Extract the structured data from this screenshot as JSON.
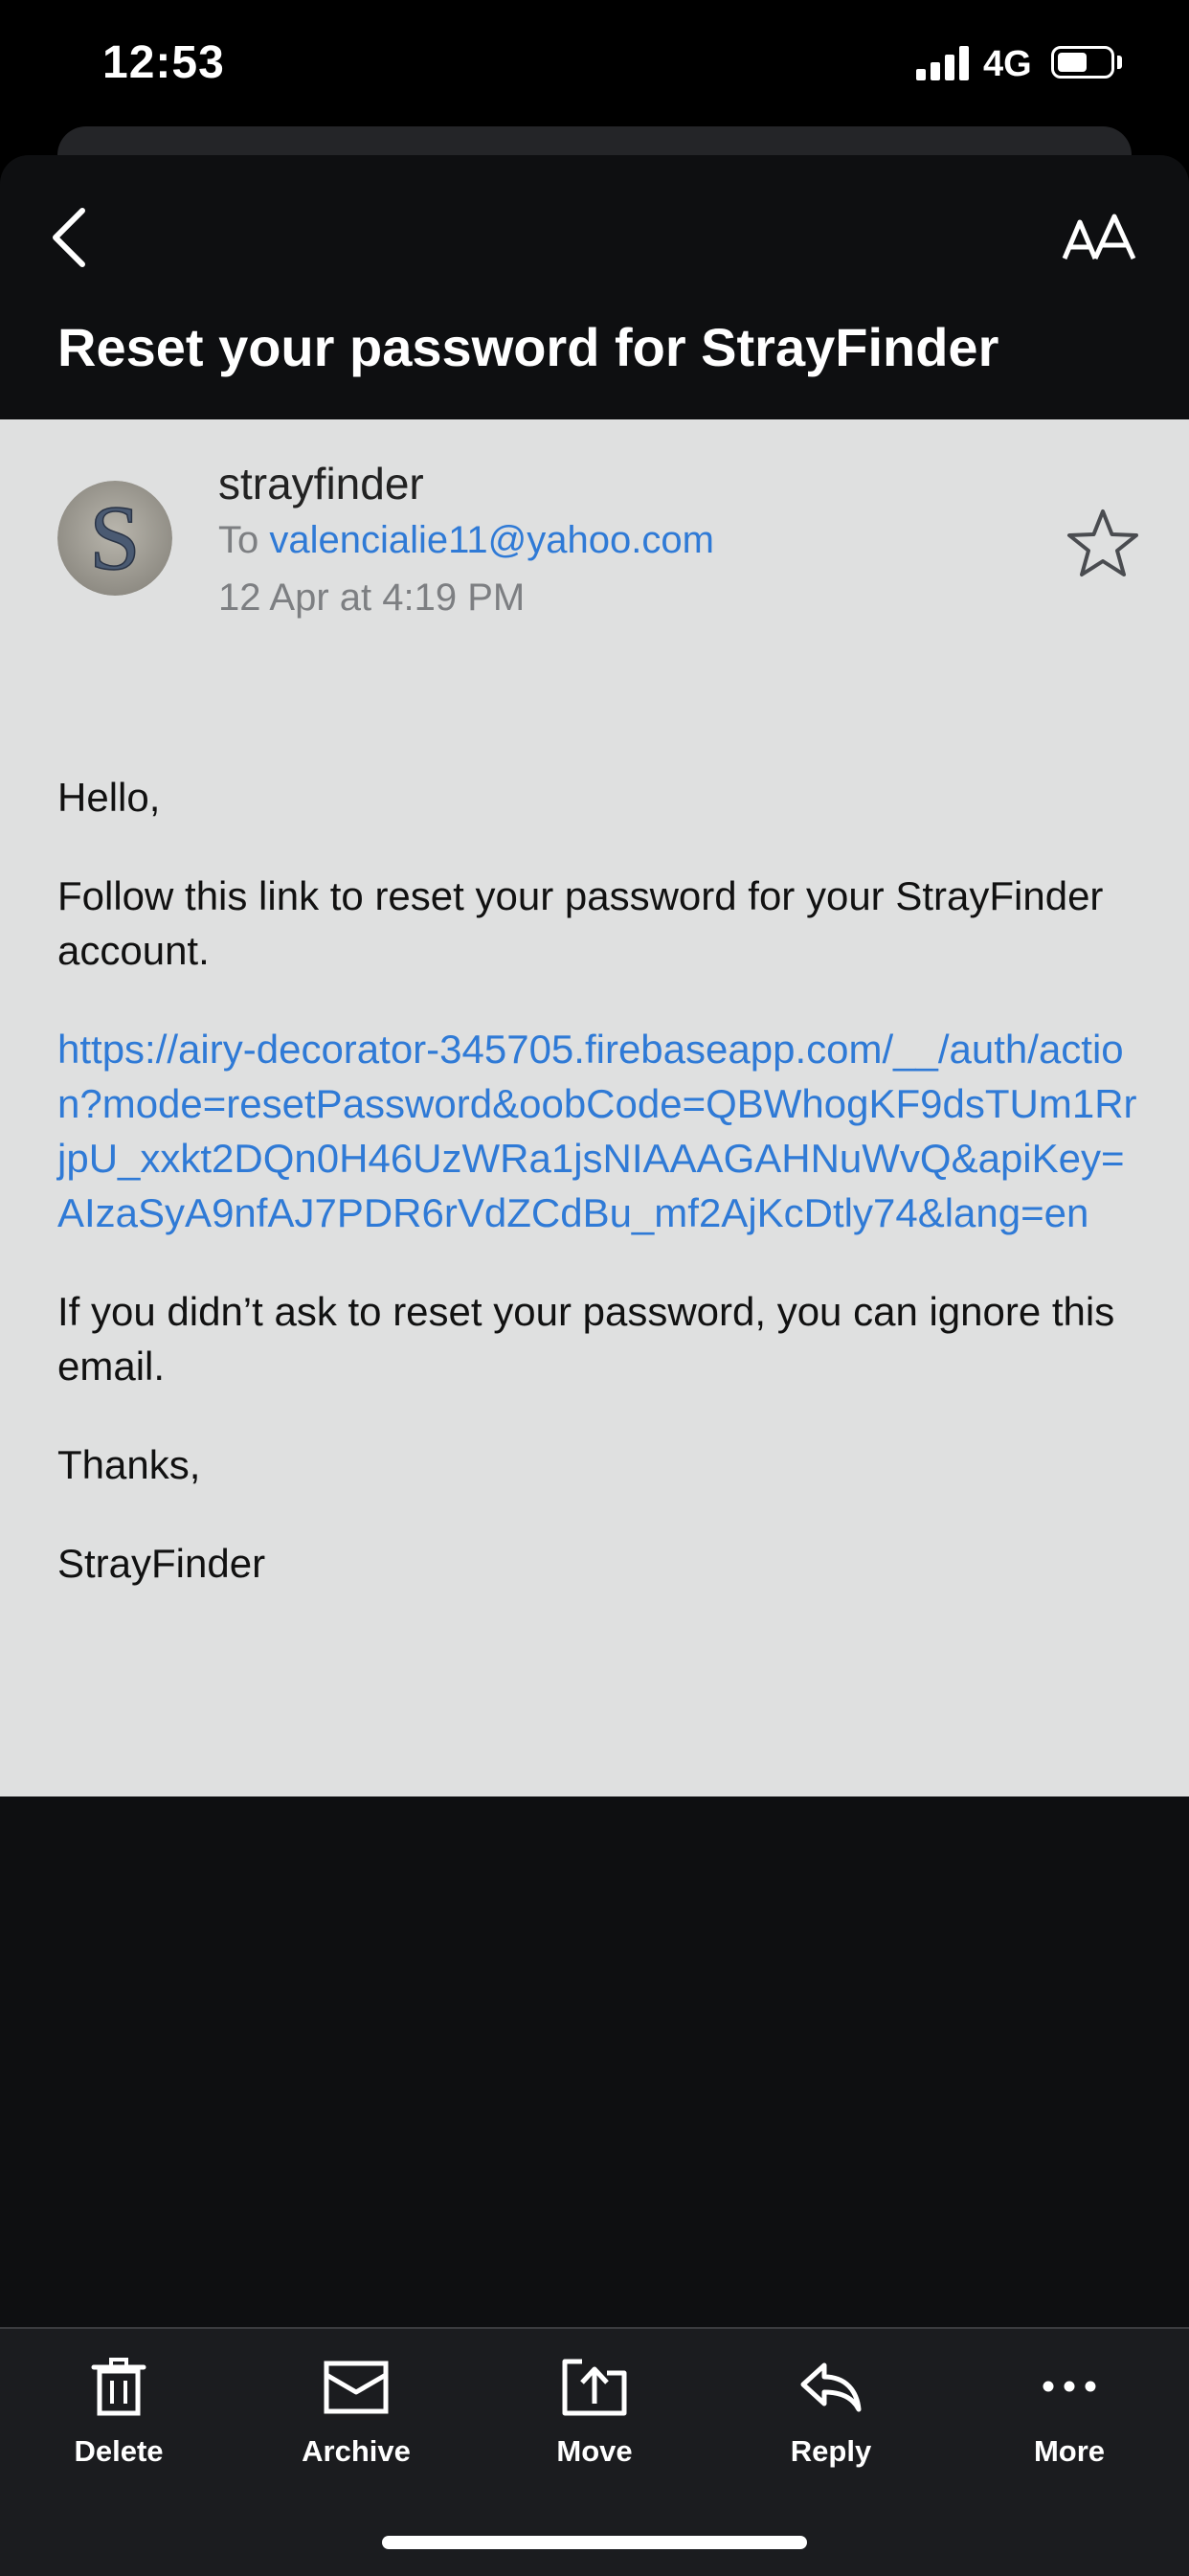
{
  "status_bar": {
    "time": "12:53",
    "network": "4G"
  },
  "header": {
    "subject": "Reset your password for StrayFinder"
  },
  "email": {
    "avatar_letter": "S",
    "sender": "strayfinder",
    "to_prefix": "To",
    "to_address": "valencialie11@yahoo.com",
    "date": "12 Apr at 4:19 PM",
    "greeting": "Hello,",
    "intro": "Follow this link to reset your password for your StrayFinder account.",
    "link": "https://airy-decorator-345705.firebaseapp.com/__/auth/action?mode=resetPassword&oobCode=QBWhogKF9dsTUm1RrjpU_xxkt2DQn0H46UzWRa1jsNIAAAGAHNuWvQ&apiKey=AIzaSyA9nfAJ7PDR6rVdZCdBu_mf2AjKcDtly74&lang=en",
    "ignore_note": "If you didn’t ask to reset your password, you can ignore this email.",
    "thanks": "Thanks,",
    "signature": "StrayFinder"
  },
  "toolbar": {
    "delete": "Delete",
    "archive": "Archive",
    "move": "Move",
    "reply": "Reply",
    "more": "More"
  },
  "colors": {
    "link": "#2f7ad6",
    "email_background": "#dfe0e0",
    "header_background": "#0e0f11",
    "toolbar_background": "#1b1c1f"
  }
}
